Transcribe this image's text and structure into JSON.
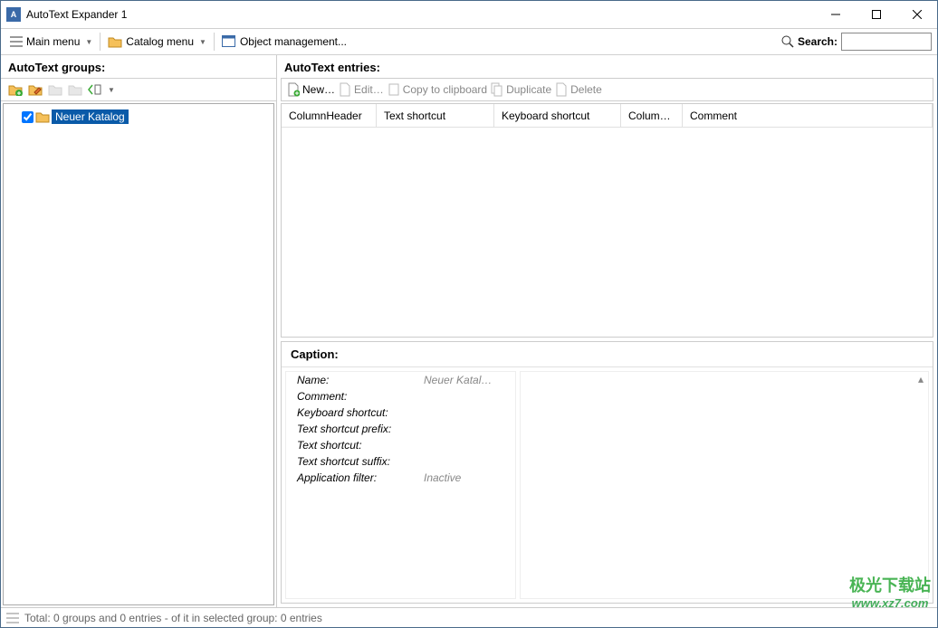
{
  "window": {
    "title": "AutoText Expander 1"
  },
  "toolbar": {
    "main_menu": "Main menu",
    "catalog_menu": "Catalog menu",
    "object_mgmt": "Object management...",
    "search_label": "Search:",
    "search_value": ""
  },
  "left": {
    "heading": "AutoText groups:",
    "tree_item": "Neuer Katalog"
  },
  "right": {
    "heading": "AutoText entries:",
    "actions": {
      "new": "New…",
      "edit": "Edit…",
      "copy": "Copy to clipboard",
      "duplicate": "Duplicate",
      "delete": "Delete"
    },
    "columns": {
      "c1": "ColumnHeader",
      "c2": "Text shortcut",
      "c3": "Keyboard shortcut",
      "c4": "Colum…",
      "c5": "Comment"
    }
  },
  "details": {
    "heading": "Caption:",
    "rows": {
      "name_l": "Name:",
      "name_v": "Neuer Katal…",
      "comment_l": "Comment:",
      "comment_v": "",
      "kbd_l": "Keyboard shortcut:",
      "kbd_v": "",
      "prefix_l": "Text shortcut prefix:",
      "prefix_v": "",
      "short_l": "Text shortcut:",
      "short_v": "",
      "suffix_l": "Text shortcut suffix:",
      "suffix_v": "",
      "appf_l": "Application filter:",
      "appf_v": "Inactive"
    }
  },
  "status": {
    "text": "Total: 0 groups and 0 entries - of it in selected group: 0 entries"
  },
  "watermark": {
    "cn": "极光下载站",
    "url": "www.xz7.com"
  }
}
